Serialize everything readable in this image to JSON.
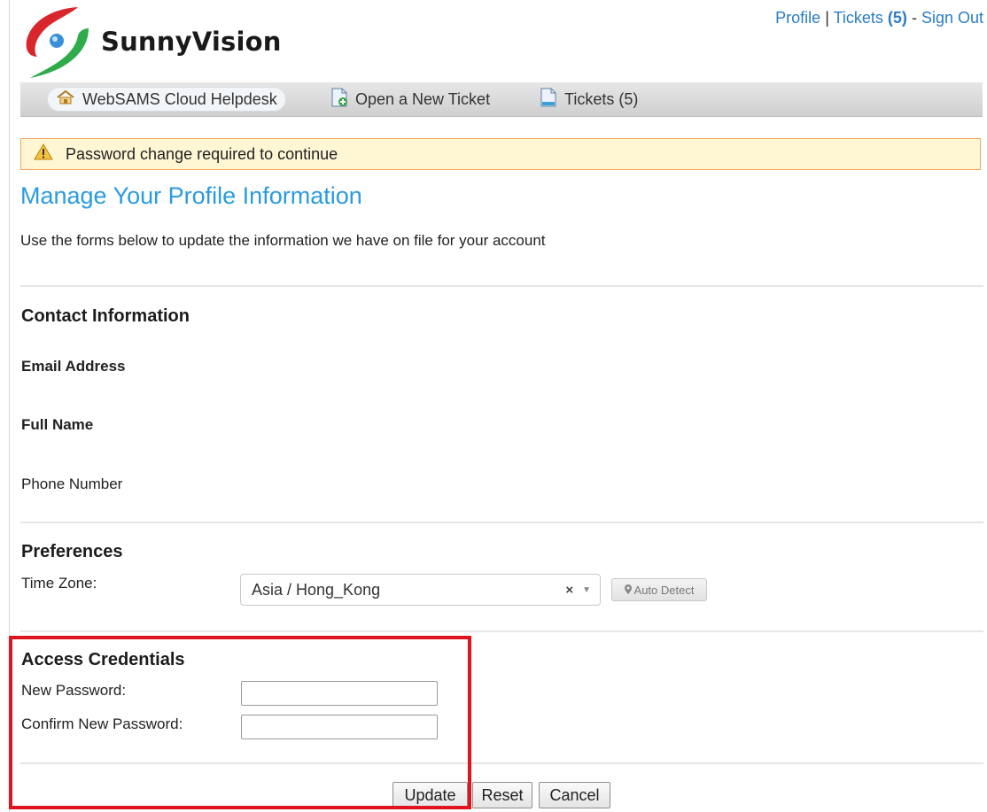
{
  "header": {
    "logo_text": "SunnyVision",
    "links": {
      "profile": "Profile",
      "sep1": "|",
      "tickets": "Tickets",
      "tickets_count": "(5)",
      "sep2": "-",
      "sign_out": "Sign Out"
    }
  },
  "nav": {
    "items": [
      {
        "label": "WebSAMS Cloud Helpdesk",
        "icon": "home-icon",
        "active": true
      },
      {
        "label": "Open a New Ticket",
        "icon": "new-ticket-icon",
        "active": false
      },
      {
        "label": "Tickets (5)",
        "icon": "tickets-icon",
        "active": false
      }
    ]
  },
  "alert": {
    "text": "Password change required to continue",
    "icon": "warning-icon"
  },
  "page": {
    "title": "Manage Your Profile Information",
    "intro": "Use the forms below to update the information we have on file for your account"
  },
  "contact": {
    "title": "Contact Information",
    "email_label": "Email Address",
    "fullname_label": "Full Name",
    "phone_label": "Phone Number"
  },
  "preferences": {
    "title": "Preferences",
    "timezone_label": "Time Zone:",
    "timezone_value": "Asia / Hong_Kong",
    "clear_symbol": "×",
    "auto_detect": "Auto Detect"
  },
  "credentials": {
    "title": "Access Credentials",
    "new_password_label": "New Password:",
    "new_password_value": "",
    "confirm_password_label": "Confirm New Password:",
    "confirm_password_value": ""
  },
  "buttons": {
    "update": "Update",
    "reset": "Reset",
    "cancel": "Cancel"
  },
  "colors": {
    "link": "#2a7dc6",
    "title": "#2a9be0",
    "alert_bg": "#fff6d4",
    "alert_border": "#f2a55c",
    "highlight": "#e0141e"
  }
}
